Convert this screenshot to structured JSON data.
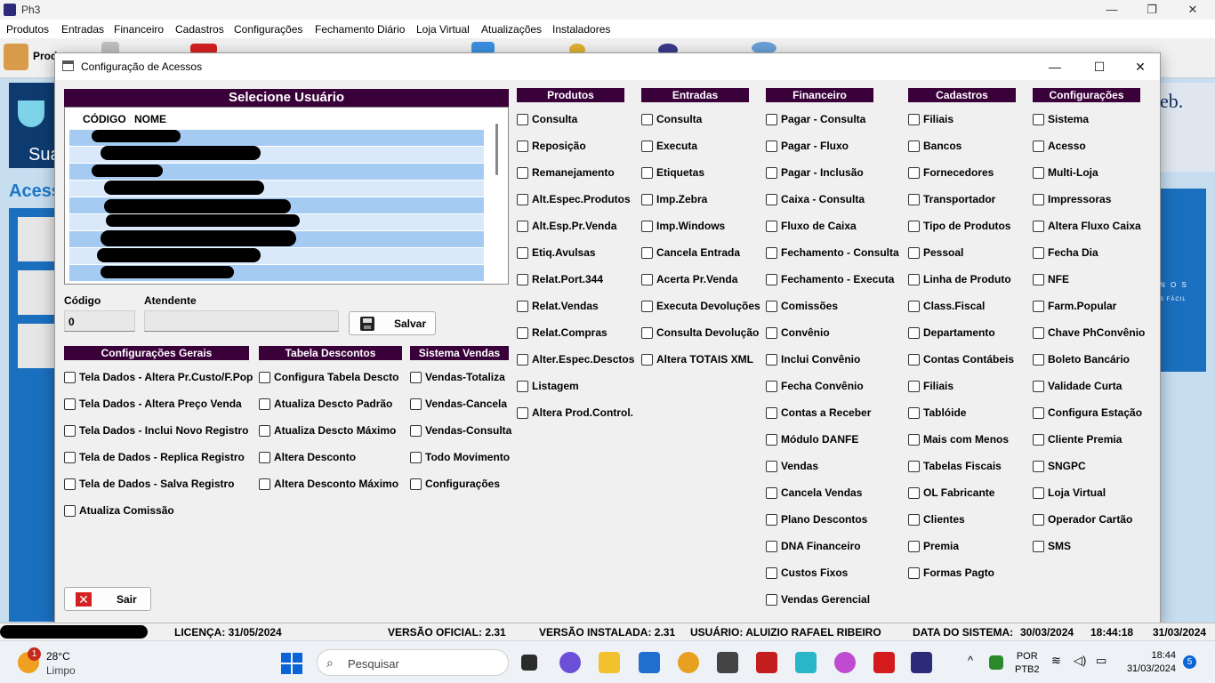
{
  "app": {
    "title": "Ph3",
    "menu": [
      "Produtos",
      "Entradas",
      "Financeiro",
      "Cadastros",
      "Configurações",
      "Fechamento Diário",
      "Loja Virtual",
      "Atualizações",
      "Instaladores"
    ],
    "toolbar_first_label": "Prod",
    "background_text": {
      "brand_left": "Sua",
      "heading": "Acesso",
      "brand_right": "eb.",
      "tag": "N O S",
      "tag2": "S FÁCIL"
    }
  },
  "dialog": {
    "title": "Configuração de Acessos",
    "select_user_title": "Selecione Usuário",
    "list_headers": {
      "code": "CÓDIGO",
      "name": "NOME"
    },
    "fields": {
      "code_label": "Código",
      "code_value": "0",
      "attendant_label": "Atendente",
      "attendant_value": ""
    },
    "save_label": "Salvar",
    "exit_label": "Sair",
    "groups": {
      "config_gerais": {
        "title": "Configurações Gerais",
        "items": [
          "Tela Dados - Altera Pr.Custo/F.Pop",
          "Tela Dados - Altera Preço Venda",
          "Tela Dados - Inclui Novo Registro",
          "Tela de Dados - Replica Registro",
          "Tela de Dados - Salva Registro",
          "Atualiza Comissão"
        ]
      },
      "tabela_descontos": {
        "title": "Tabela Descontos",
        "items": [
          "Configura Tabela Descto",
          "Atualiza Descto Padrão",
          "Atualiza Descto Máximo",
          "Altera Desconto",
          "Altera Desconto Máximo"
        ]
      },
      "sistema_vendas": {
        "title": "Sistema Vendas",
        "items": [
          "Vendas-Totaliza",
          "Vendas-Cancela",
          "Vendas-Consulta",
          "Todo Movimento",
          "Configurações"
        ]
      },
      "produtos": {
        "title": "Produtos",
        "items": [
          "Consulta",
          "Reposição",
          "Remanejamento",
          "Alt.Espec.Produtos",
          "Alt.Esp.Pr.Venda",
          "Etiq.Avulsas",
          "Relat.Port.344",
          "Relat.Vendas",
          "Relat.Compras",
          "Alter.Espec.Desctos",
          "Listagem",
          "Altera Prod.Control."
        ]
      },
      "entradas": {
        "title": "Entradas",
        "items": [
          "Consulta",
          "Executa",
          "Etiquetas",
          "Imp.Zebra",
          "Imp.Windows",
          "Cancela Entrada",
          "Acerta Pr.Venda",
          "Executa Devoluções",
          "Consulta Devolução",
          "Altera TOTAIS XML"
        ]
      },
      "financeiro": {
        "title": "Financeiro",
        "items": [
          "Pagar - Consulta",
          "Pagar - Fluxo",
          "Pagar - Inclusão",
          "Caixa - Consulta",
          "Fluxo de Caixa",
          "Fechamento - Consulta",
          "Fechamento - Executa",
          "Comissões",
          "Convênio",
          "Inclui Convênio",
          "Fecha Convênio",
          "Contas a Receber",
          "Módulo DANFE",
          "Vendas",
          "Cancela Vendas",
          "Plano Descontos",
          "DNA Financeiro",
          "Custos Fixos",
          "Vendas Gerencial"
        ]
      },
      "cadastros": {
        "title": "Cadastros",
        "items": [
          "Filiais",
          "Bancos",
          "Fornecedores",
          "Transportador",
          "Tipo de Produtos",
          "Pessoal",
          "Linha de Produto",
          "Class.Fiscal",
          "Departamento",
          "Contas Contábeis",
          "Filiais",
          "Tablóide",
          "Mais com Menos",
          "Tabelas Fiscais",
          "OL Fabricante",
          "Clientes",
          "Premia",
          "Formas Pagto"
        ]
      },
      "configuracoes": {
        "title": "Configurações",
        "items": [
          "Sistema",
          "Acesso",
          "Multi-Loja",
          "Impressoras",
          "Altera Fluxo Caixa",
          "Fecha Dia",
          "NFE",
          "Farm.Popular",
          "Chave PhConvênio",
          "Boleto Bancário",
          "Validade Curta",
          "Configura Estação",
          "Cliente Premia",
          "SNGPC",
          "Loja Virtual",
          "Operador Cartão",
          "SMS"
        ]
      }
    }
  },
  "status": {
    "license": "LICENÇA: 31/05/2024",
    "official_version": "VERSÃO OFICIAL: 2.31",
    "installed_version": "VERSÃO INSTALADA: 2.31",
    "user": "USUÁRIO: ALUIZIO RAFAEL RIBEIRO",
    "system_date_label": "DATA DO SISTEMA:",
    "system_date": "30/03/2024",
    "time": "18:44:18",
    "date": "31/03/2024"
  },
  "taskbar": {
    "weather_badge": "1",
    "temperature": "28°C",
    "condition": "Limpo",
    "search_placeholder": "Pesquisar",
    "lang_1": "POR",
    "lang_2": "PTB2",
    "clock_time": "18:44",
    "clock_date": "31/03/2024",
    "notifications": "5"
  },
  "colors": {
    "header_bg": "#3a003a",
    "row_odd": "#a6cbf2",
    "row_even": "#dae9fa",
    "accent": "#1b6fbf"
  }
}
